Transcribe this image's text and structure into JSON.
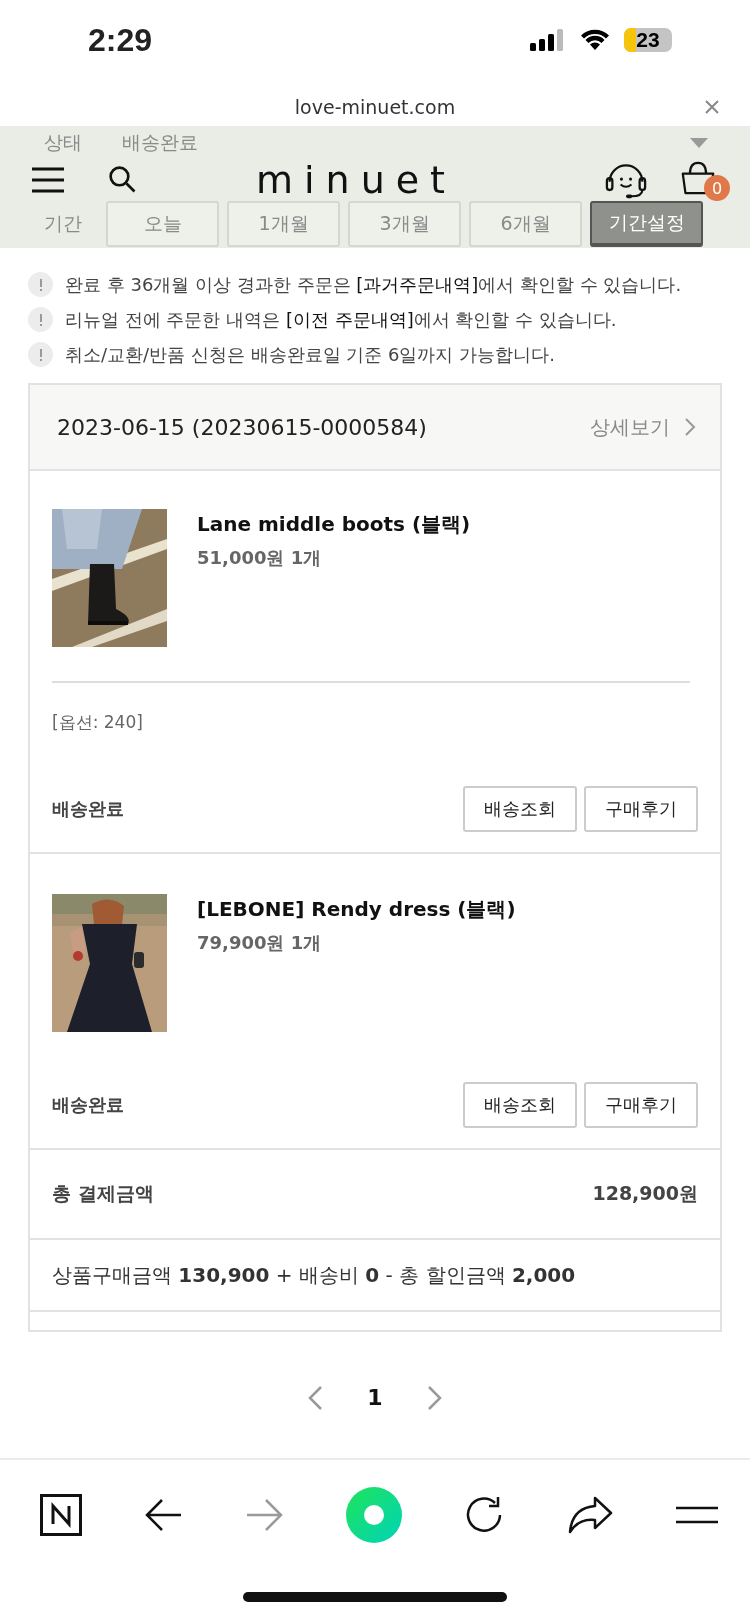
{
  "status_bar": {
    "time": "2:29",
    "battery": "23"
  },
  "browser": {
    "url": "love-minuet.com"
  },
  "header": {
    "logo": "minuet",
    "cart_count": "0"
  },
  "filter": {
    "status_label": "상태",
    "status_value": "배송완료",
    "period_label": "기간",
    "periods": [
      {
        "label": "오늘",
        "selected": false
      },
      {
        "label": "1개월",
        "selected": false
      },
      {
        "label": "3개월",
        "selected": false
      },
      {
        "label": "6개월",
        "selected": false
      },
      {
        "label": "기간설정",
        "selected": true
      }
    ]
  },
  "notices": [
    "완료 후 36개월 이상 경과한 주문은 **[과거주문내역]**에서 확인할 수 있습니다.",
    "리뉴얼 전에 주문한 내역은 **[이전 주문내역]**에서 확인할 수 있습니다.",
    "취소/교환/반품 신청은 배송완료일 기준 6일까지 가능합니다."
  ],
  "order": {
    "date": "2023-06-15 (20230615-0000584)",
    "detail_link": "상세보기",
    "items": [
      {
        "name": "Lane middle boots (블랙)",
        "price": "51,000원 1개",
        "option": "[옵션: 240]",
        "status": "배송완료",
        "buttons": [
          "배송조회",
          "구매후기"
        ]
      },
      {
        "name": "[LEBONE] Rendy dress (블랙)",
        "price": "79,900원 1개",
        "status": "배송완료",
        "buttons": [
          "배송조회",
          "구매후기"
        ]
      }
    ],
    "total_label": "총 결제금액",
    "total_value": "128,900원",
    "breakdown": "상품구매금액 **130,900** + 배송비 **0** - 총 할인금액 **2,000**"
  },
  "pagination": {
    "pages": [
      {
        "label": "1",
        "selected": true
      }
    ]
  }
}
